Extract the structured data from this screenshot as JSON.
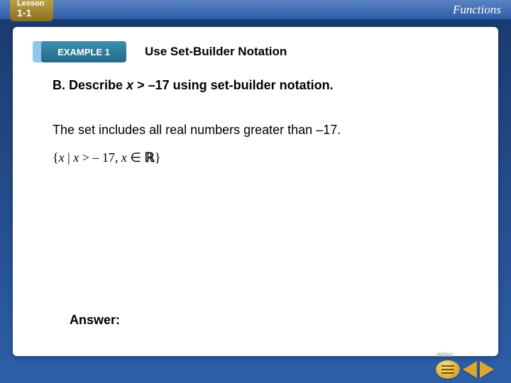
{
  "header": {
    "lesson_label": "Lesson",
    "lesson_number": "1-1",
    "unit_title": "Functions"
  },
  "slide": {
    "badge_label": "EXAMPLE 1",
    "title": "Use Set-Builder Notation",
    "question_prefix": "B. Describe ",
    "question_var": "x",
    "question_rest": " > –17 using set-builder notation.",
    "explanation": "The set includes all real numbers greater than –17.",
    "set_builder": "{ x | x > – 17, x ∈ ℝ }",
    "answer_label": "Answer:"
  },
  "nav": {
    "menu_label": "MENU"
  }
}
